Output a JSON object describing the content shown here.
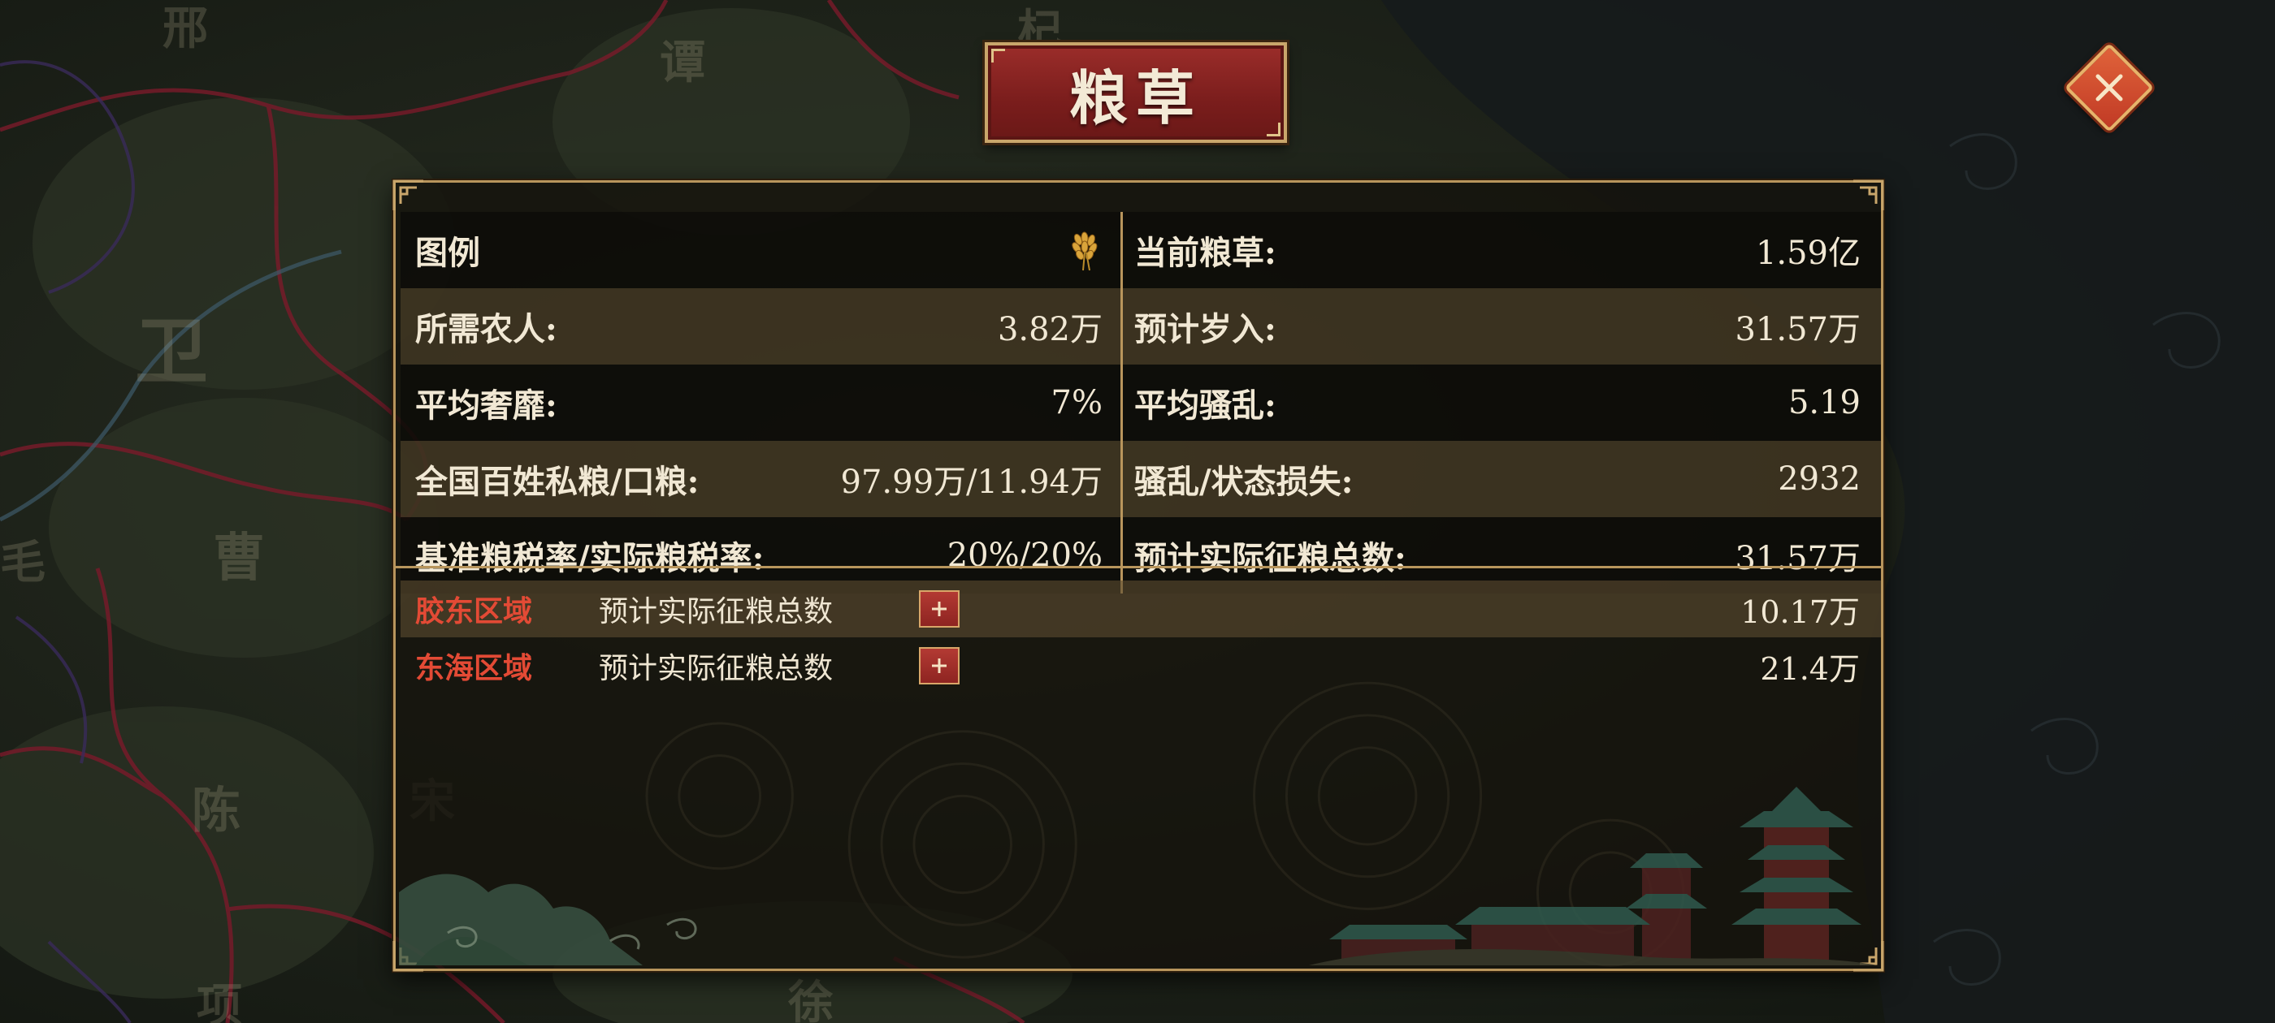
{
  "title": "粮草",
  "close": {
    "icon": "close-icon"
  },
  "map": {
    "labels": [
      "邢",
      "谭",
      "杞",
      "卫",
      "曹",
      "毛",
      "陈",
      "宋",
      "项",
      "徐"
    ],
    "line_colors": {
      "border_red": "#7a1a2a",
      "border_purple": "#3a2a5a",
      "river": "#3d5a6a"
    }
  },
  "stats": {
    "rows": [
      {
        "left": {
          "label": "图例",
          "icon": "grain-icon"
        },
        "right": {
          "label": "当前粮草:",
          "value": "1.59亿"
        }
      },
      {
        "left": {
          "label": "所需农人:",
          "value": "3.82万"
        },
        "right": {
          "label": "预计岁入:",
          "value": "31.57万"
        }
      },
      {
        "left": {
          "label": "平均奢靡:",
          "value": "7%"
        },
        "right": {
          "label": "平均骚乱:",
          "value": "5.19"
        }
      },
      {
        "left": {
          "label": "全国百姓私粮/口粮:",
          "value": "97.99万/11.94万"
        },
        "right": {
          "label": "骚乱/状态损失:",
          "value": "2932"
        }
      },
      {
        "left": {
          "label": "基准粮税率/实际粮税率:",
          "value": "20%/20%"
        },
        "right": {
          "label": "预计实际征粮总数:",
          "value": "31.57万"
        }
      }
    ]
  },
  "regions": [
    {
      "name": "胶东区域",
      "desc": "预计实际征粮总数",
      "value": "10.17万"
    },
    {
      "name": "东海区域",
      "desc": "预计实际征粮总数",
      "value": "21.4万"
    }
  ],
  "colors": {
    "panel_border": "#b8955c",
    "region_name": "#e34a35",
    "title_plaque": "#8a2624",
    "close_button": "#d24e30"
  }
}
